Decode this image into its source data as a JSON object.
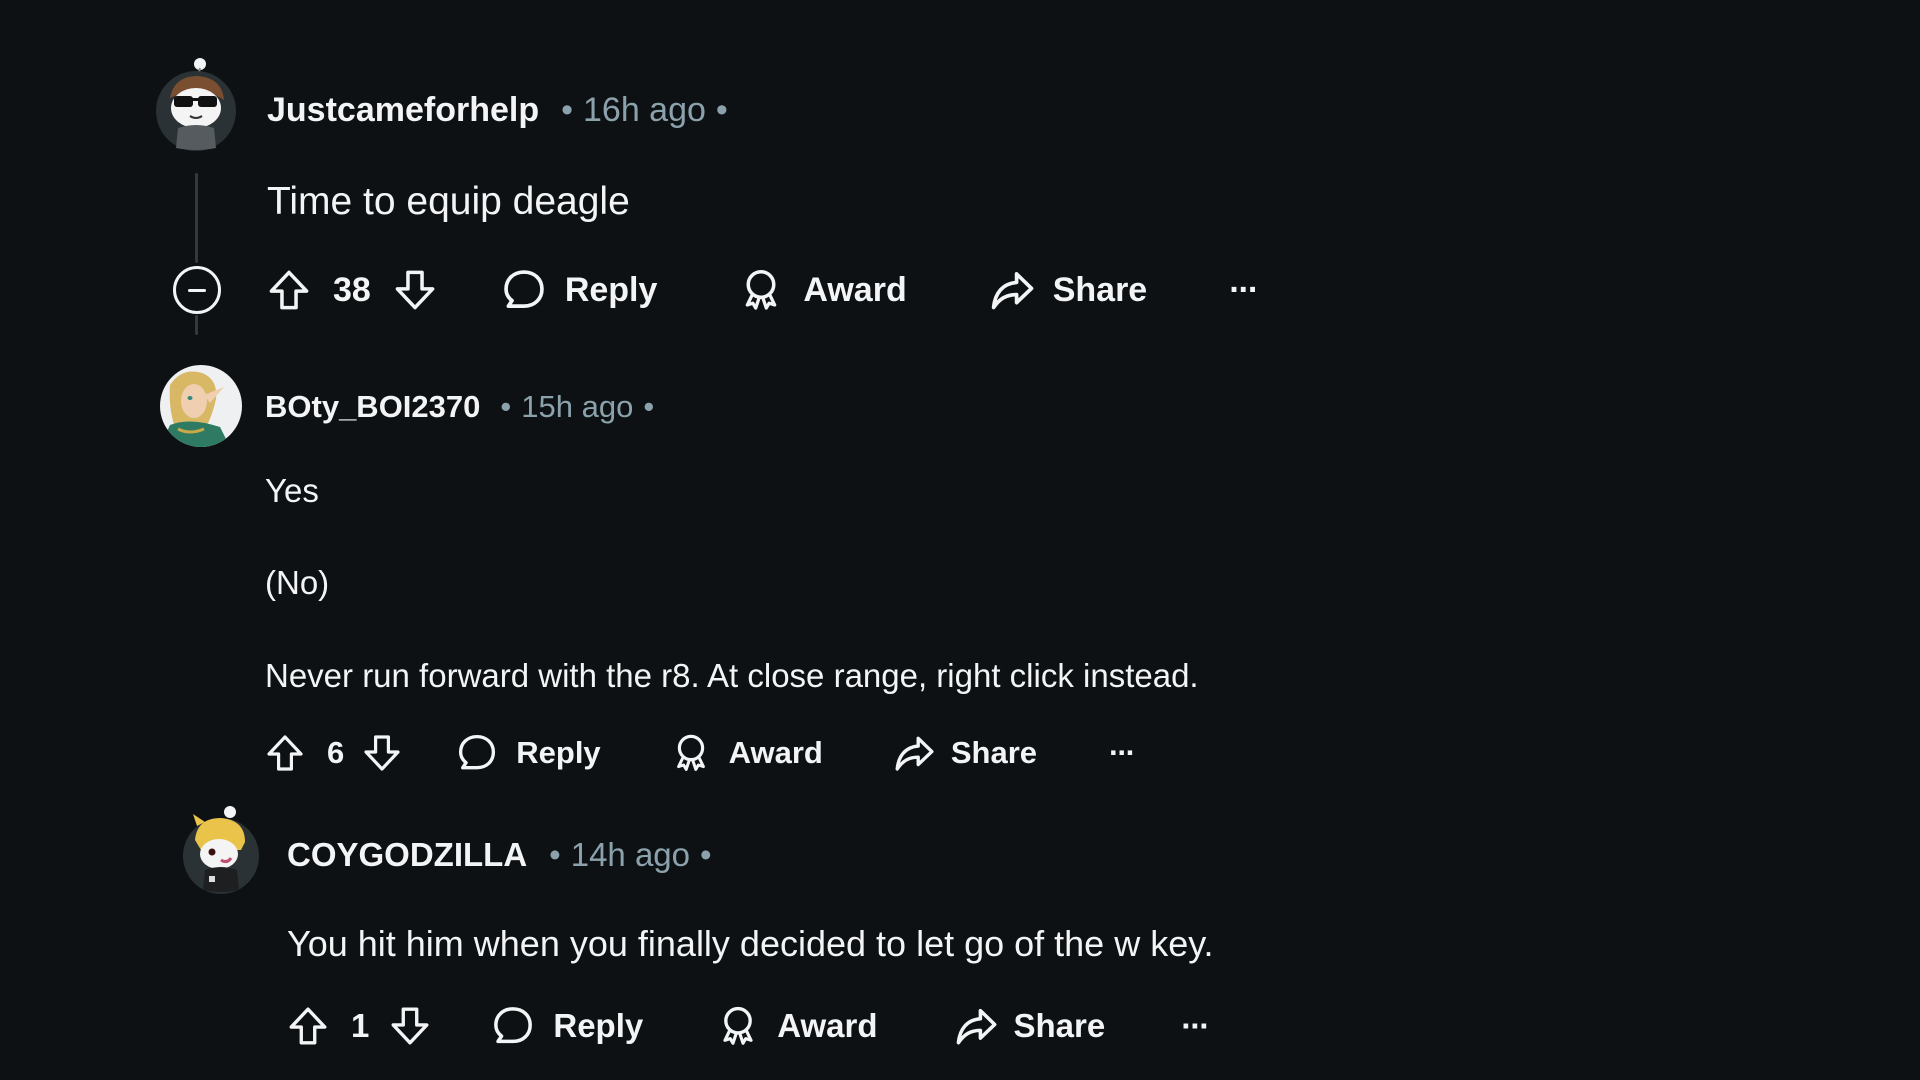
{
  "comments": [
    {
      "username": "Justcameforhelp",
      "separator": "•",
      "time": "16h ago",
      "body": [
        "Time to equip deagle"
      ],
      "score": "38",
      "actions": {
        "reply": "Reply",
        "award": "Award",
        "share": "Share",
        "more": "···"
      },
      "avatar": "snoo-avatar-sunglasses",
      "collapsible": true
    },
    {
      "username": "BOty_BOI2370",
      "separator": "•",
      "time": "15h ago",
      "body": [
        "Yes",
        "(No)",
        "Never run forward with the r8. At close range, right click instead."
      ],
      "score": "6",
      "actions": {
        "reply": "Reply",
        "award": "Award",
        "share": "Share",
        "more": "···"
      },
      "avatar": "elf-portrait-avatar"
    },
    {
      "username": "COYGODZILLA",
      "separator": "•",
      "time": "14h ago",
      "body": [
        "You hit him when you finally decided to let go of the w key."
      ],
      "score": "1",
      "actions": {
        "reply": "Reply",
        "award": "Award",
        "share": "Share",
        "more": "···"
      },
      "avatar": "snoo-avatar-tiger-hood"
    }
  ],
  "colors": {
    "background": "#0e1113",
    "text": "#f2f4f5",
    "meta": "#8ba2ad",
    "thread_line": "#33393d"
  }
}
